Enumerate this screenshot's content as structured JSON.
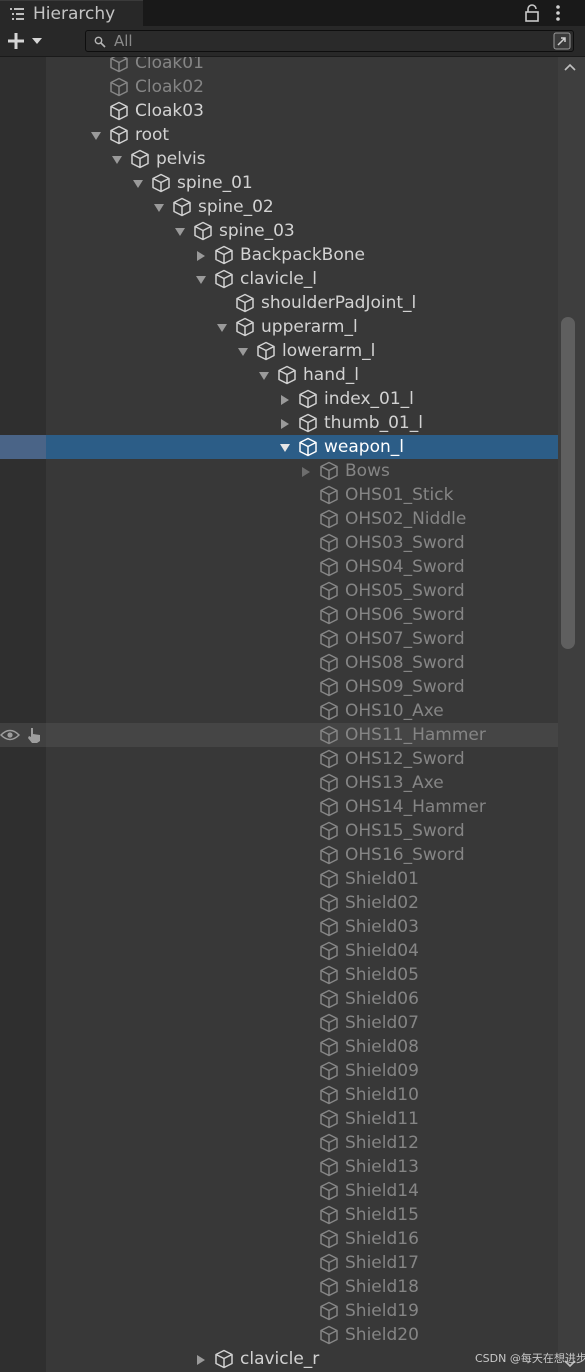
{
  "window": {
    "tab_title": "Hierarchy"
  },
  "toolbar": {
    "search_placeholder": "All"
  },
  "tree": [
    {
      "label": "Cloak01",
      "depth": 0,
      "arrow": "none",
      "dim": true
    },
    {
      "label": "Cloak02",
      "depth": 0,
      "arrow": "none",
      "dim": true
    },
    {
      "label": "Cloak03",
      "depth": 0,
      "arrow": "none"
    },
    {
      "label": "root",
      "depth": 0,
      "arrow": "down"
    },
    {
      "label": "pelvis",
      "depth": 1,
      "arrow": "down"
    },
    {
      "label": "spine_01",
      "depth": 2,
      "arrow": "down"
    },
    {
      "label": "spine_02",
      "depth": 3,
      "arrow": "down"
    },
    {
      "label": "spine_03",
      "depth": 4,
      "arrow": "down"
    },
    {
      "label": "BackpackBone",
      "depth": 5,
      "arrow": "right"
    },
    {
      "label": "clavicle_l",
      "depth": 5,
      "arrow": "down"
    },
    {
      "label": "shoulderPadJoint_l",
      "depth": 6,
      "arrow": "none"
    },
    {
      "label": "upperarm_l",
      "depth": 6,
      "arrow": "down"
    },
    {
      "label": "lowerarm_l",
      "depth": 7,
      "arrow": "down"
    },
    {
      "label": "hand_l",
      "depth": 8,
      "arrow": "down"
    },
    {
      "label": "index_01_l",
      "depth": 9,
      "arrow": "right"
    },
    {
      "label": "thumb_01_l",
      "depth": 9,
      "arrow": "right"
    },
    {
      "label": "weapon_l",
      "depth": 9,
      "arrow": "down",
      "selected": true
    },
    {
      "label": "Bows",
      "depth": 10,
      "arrow": "right",
      "dim": true
    },
    {
      "label": "OHS01_Stick",
      "depth": 10,
      "arrow": "none",
      "dim": true
    },
    {
      "label": "OHS02_Niddle",
      "depth": 10,
      "arrow": "none",
      "dim": true
    },
    {
      "label": "OHS03_Sword",
      "depth": 10,
      "arrow": "none",
      "dim": true
    },
    {
      "label": "OHS04_Sword",
      "depth": 10,
      "arrow": "none",
      "dim": true
    },
    {
      "label": "OHS05_Sword",
      "depth": 10,
      "arrow": "none",
      "dim": true
    },
    {
      "label": "OHS06_Sword",
      "depth": 10,
      "arrow": "none",
      "dim": true
    },
    {
      "label": "OHS07_Sword",
      "depth": 10,
      "arrow": "none",
      "dim": true
    },
    {
      "label": "OHS08_Sword",
      "depth": 10,
      "arrow": "none",
      "dim": true
    },
    {
      "label": "OHS09_Sword",
      "depth": 10,
      "arrow": "none",
      "dim": true
    },
    {
      "label": "OHS10_Axe",
      "depth": 10,
      "arrow": "none",
      "dim": true
    },
    {
      "label": "OHS11_Hammer",
      "depth": 10,
      "arrow": "none",
      "dim": true,
      "hovered": true
    },
    {
      "label": "OHS12_Sword",
      "depth": 10,
      "arrow": "none",
      "dim": true
    },
    {
      "label": "OHS13_Axe",
      "depth": 10,
      "arrow": "none",
      "dim": true
    },
    {
      "label": "OHS14_Hammer",
      "depth": 10,
      "arrow": "none",
      "dim": true
    },
    {
      "label": "OHS15_Sword",
      "depth": 10,
      "arrow": "none",
      "dim": true
    },
    {
      "label": "OHS16_Sword",
      "depth": 10,
      "arrow": "none",
      "dim": true
    },
    {
      "label": "Shield01",
      "depth": 10,
      "arrow": "none",
      "dim": true
    },
    {
      "label": "Shield02",
      "depth": 10,
      "arrow": "none",
      "dim": true
    },
    {
      "label": "Shield03",
      "depth": 10,
      "arrow": "none",
      "dim": true
    },
    {
      "label": "Shield04",
      "depth": 10,
      "arrow": "none",
      "dim": true
    },
    {
      "label": "Shield05",
      "depth": 10,
      "arrow": "none",
      "dim": true
    },
    {
      "label": "Shield06",
      "depth": 10,
      "arrow": "none",
      "dim": true
    },
    {
      "label": "Shield07",
      "depth": 10,
      "arrow": "none",
      "dim": true
    },
    {
      "label": "Shield08",
      "depth": 10,
      "arrow": "none",
      "dim": true
    },
    {
      "label": "Shield09",
      "depth": 10,
      "arrow": "none",
      "dim": true
    },
    {
      "label": "Shield10",
      "depth": 10,
      "arrow": "none",
      "dim": true
    },
    {
      "label": "Shield11",
      "depth": 10,
      "arrow": "none",
      "dim": true
    },
    {
      "label": "Shield12",
      "depth": 10,
      "arrow": "none",
      "dim": true
    },
    {
      "label": "Shield13",
      "depth": 10,
      "arrow": "none",
      "dim": true
    },
    {
      "label": "Shield14",
      "depth": 10,
      "arrow": "none",
      "dim": true
    },
    {
      "label": "Shield15",
      "depth": 10,
      "arrow": "none",
      "dim": true
    },
    {
      "label": "Shield16",
      "depth": 10,
      "arrow": "none",
      "dim": true
    },
    {
      "label": "Shield17",
      "depth": 10,
      "arrow": "none",
      "dim": true
    },
    {
      "label": "Shield18",
      "depth": 10,
      "arrow": "none",
      "dim": true
    },
    {
      "label": "Shield19",
      "depth": 10,
      "arrow": "none",
      "dim": true
    },
    {
      "label": "Shield20",
      "depth": 10,
      "arrow": "none",
      "dim": true
    },
    {
      "label": "clavicle_r",
      "depth": 5,
      "arrow": "right"
    }
  ],
  "icons": {
    "tab": "hierarchy-list-icon",
    "lock": "lock-icon",
    "menu": "kebab-menu-icon",
    "add": "plus-icon",
    "search": "search-icon",
    "toggle": "scene-search-icon",
    "node": "gameobject-cube-icon",
    "visibility": "eye-icon",
    "pickable": "hand-pointer-icon"
  },
  "colors": {
    "selection": "#2c5d87",
    "background": "#383838",
    "toolbar": "#282828"
  },
  "watermark": "CSDN @每天在想进步"
}
